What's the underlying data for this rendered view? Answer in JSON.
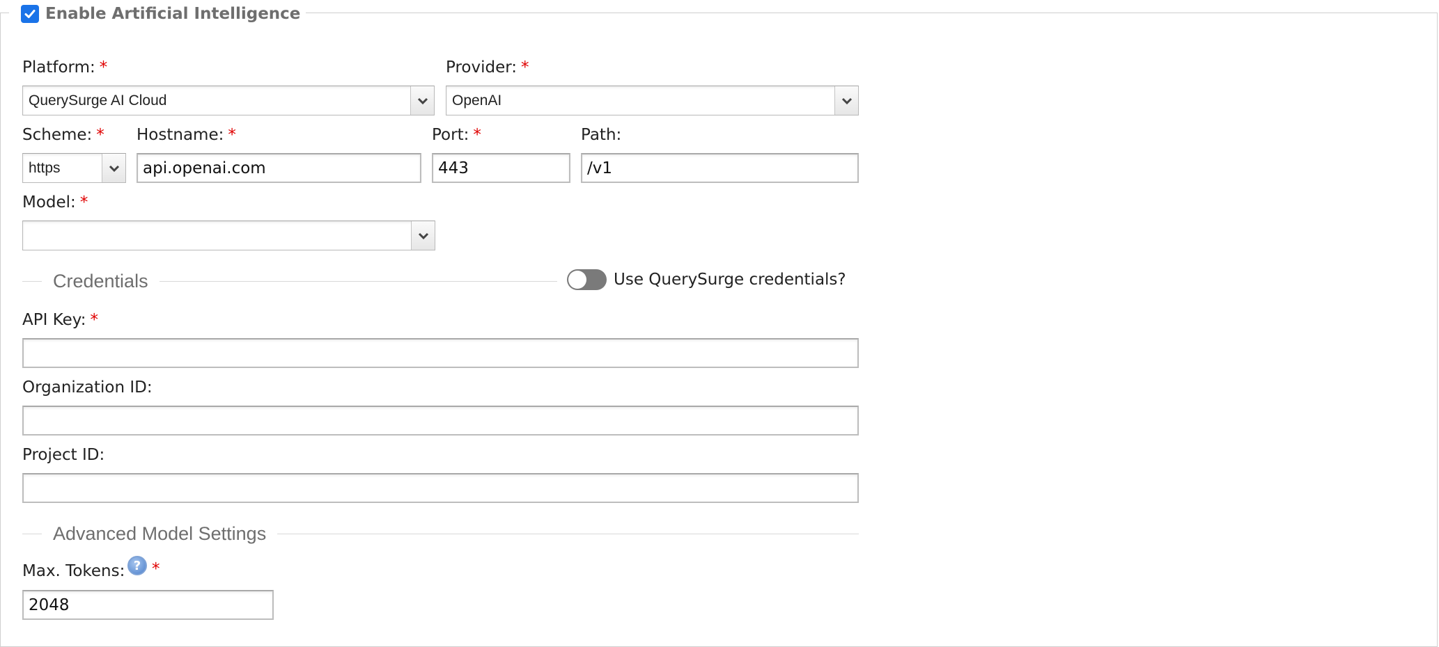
{
  "fieldset": {
    "legend": "Enable Artificial Intelligence",
    "enabled": true
  },
  "required_mark": "*",
  "platform": {
    "label": "Platform:",
    "value": "QuerySurge AI Cloud"
  },
  "provider": {
    "label": "Provider:",
    "value": "OpenAI"
  },
  "scheme": {
    "label": "Scheme:",
    "value": "https"
  },
  "hostname": {
    "label": "Hostname:",
    "value": "api.openai.com"
  },
  "port": {
    "label": "Port:",
    "value": "443"
  },
  "path": {
    "label": "Path:",
    "value": "/v1"
  },
  "model": {
    "label": "Model:",
    "value": ""
  },
  "credentials": {
    "title": "Credentials",
    "use_querysurge_label": "Use QuerySurge credentials?",
    "use_querysurge": false,
    "api_key": {
      "label": "API Key:",
      "value": ""
    },
    "organization_id": {
      "label": "Organization ID:",
      "value": ""
    },
    "project_id": {
      "label": "Project ID:",
      "value": ""
    }
  },
  "advanced": {
    "title": "Advanced Model Settings",
    "max_tokens": {
      "label": "Max. Tokens:",
      "value": "2048"
    },
    "help_glyph": "?"
  },
  "colors": {
    "accent": "#1a73e8",
    "required": "#e00000",
    "toggle_off": "#7a7a7a"
  },
  "icons": {
    "checkbox": "check-icon",
    "dropdown": "chevron-down-icon",
    "help": "help-icon"
  }
}
